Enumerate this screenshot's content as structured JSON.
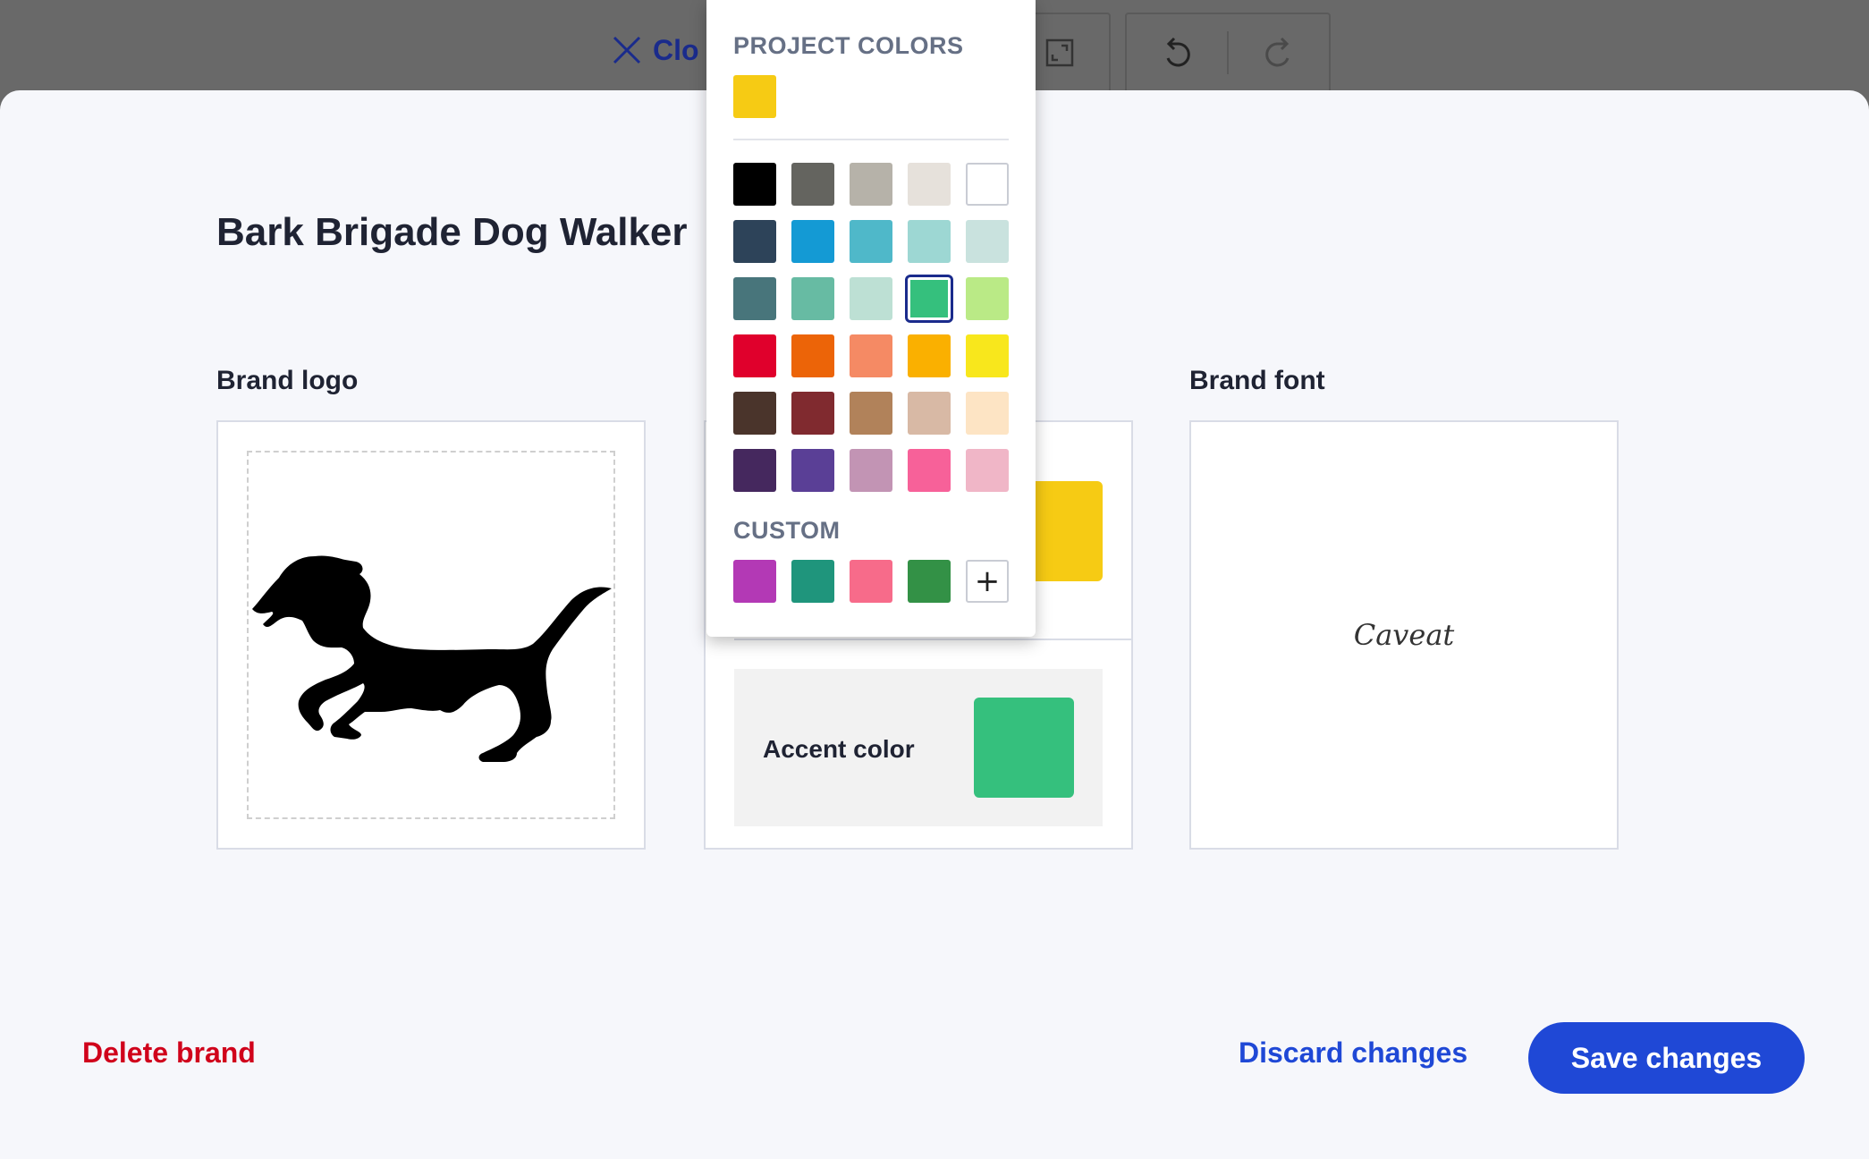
{
  "toolbar": {
    "close_label": "Clo",
    "expand_icon": "expand-icon",
    "undo_icon": "undo-icon",
    "redo_icon": "redo-icon"
  },
  "brand": {
    "name": "Bark Brigade Dog Walker"
  },
  "sections": {
    "logo_label": "Brand logo",
    "font_label": "Brand font"
  },
  "colors_card": {
    "primary_color": "#f6cb14",
    "accent_label": "Accent color",
    "accent_color": "#35c07d"
  },
  "font_card": {
    "sample": "Caveat"
  },
  "picker": {
    "project_heading": "PROJECT COLORS",
    "project_colors": [
      "#f6cb14"
    ],
    "palette_rows": [
      [
        "#000000",
        "#64645f",
        "#b6b2a9",
        "#e6e1db",
        "#ffffff"
      ],
      [
        "#2d4359",
        "#149ad4",
        "#4fb8c9",
        "#9dd7d3",
        "#c9e2de"
      ],
      [
        "#48757b",
        "#67bba3",
        "#bde0d4",
        "#35c07d",
        "#baea86"
      ],
      [
        "#e0002c",
        "#ec6408",
        "#f58a64",
        "#fab000",
        "#f8e71c"
      ],
      [
        "#4a342b",
        "#802a2f",
        "#b1825a",
        "#d8b9a5",
        "#fde4c4"
      ],
      [
        "#45285e",
        "#5a3f96",
        "#c294b4",
        "#f76199",
        "#f0b6c7"
      ]
    ],
    "selected_color": "#35c07d",
    "custom_heading": "CUSTOM",
    "custom_colors": [
      "#b339b5",
      "#1f957c",
      "#f76b8a",
      "#339146"
    ],
    "add_label": "+"
  },
  "footer": {
    "delete_label": "Delete brand",
    "discard_label": "Discard changes",
    "save_label": "Save changes"
  }
}
